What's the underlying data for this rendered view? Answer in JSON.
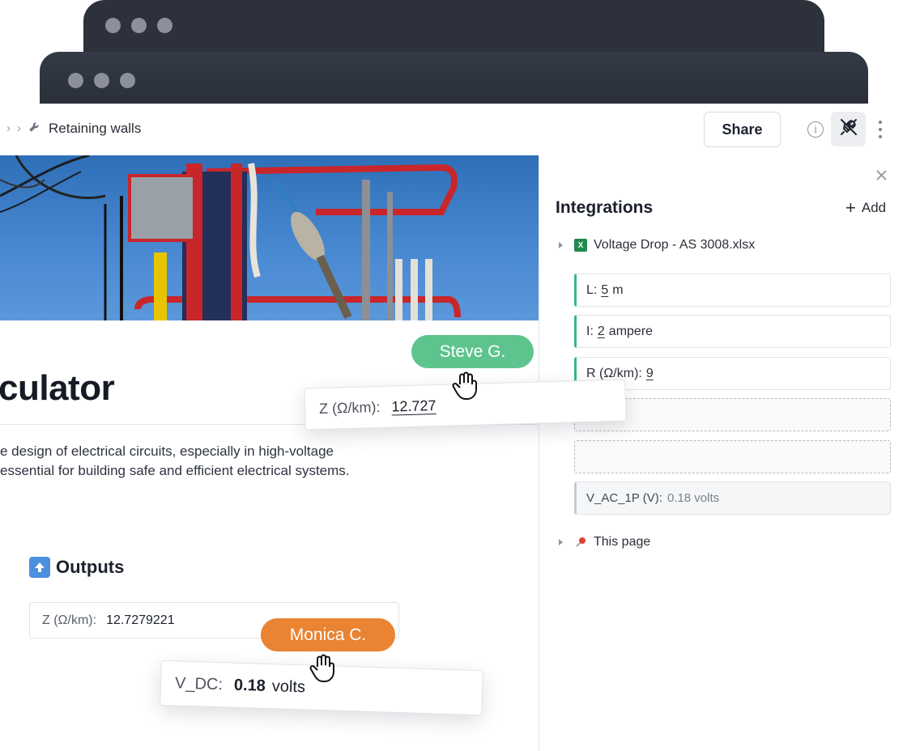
{
  "breadcrumb": {
    "page_title": "Retaining walls"
  },
  "toolbar": {
    "share_label": "Share",
    "info_icon": "info-icon",
    "plug_icon": "plug-icon",
    "more_icon": "more-vertical-icon"
  },
  "document": {
    "title_fragment": "culator",
    "paragraph_line1": "e design of electrical circuits, especially in high-voltage",
    "paragraph_line2": "essential for building safe and efficient electrical systems.",
    "outputs_heading": "Outputs",
    "outputs_icon": "up-arrow-icon",
    "output_z": {
      "label": "Z (Ω/km):",
      "value": "12.7279221"
    }
  },
  "integrations": {
    "title": "Integrations",
    "add_label": "Add",
    "file": {
      "name": "Voltage Drop - AS 3008.xlsx",
      "icon": "excel-icon"
    },
    "inputs": [
      {
        "label": "L:",
        "value": "5",
        "unit": "m"
      },
      {
        "label": "I:",
        "value": "2",
        "unit": "ampere"
      },
      {
        "label": "R (Ω/km):",
        "value": "9",
        "unit": ""
      }
    ],
    "result": {
      "label": "V_AC_1P (V):",
      "value": "0.18 volts"
    },
    "this_page": {
      "label": "This page",
      "icon": "pin-icon"
    }
  },
  "collaborators": {
    "steve": "Steve G.",
    "monica": "Monica C."
  },
  "drag_cards": {
    "z_card": {
      "label": "Z (Ω/km):",
      "value": "12.727"
    },
    "v_card": {
      "label": "V_DC:",
      "value": "0.18",
      "unit": "volts"
    }
  },
  "colors": {
    "accent_green": "#34b980",
    "steve_pill": "#5ec48d",
    "monica_pill": "#ea8332",
    "window_chrome": "#2c313b"
  }
}
